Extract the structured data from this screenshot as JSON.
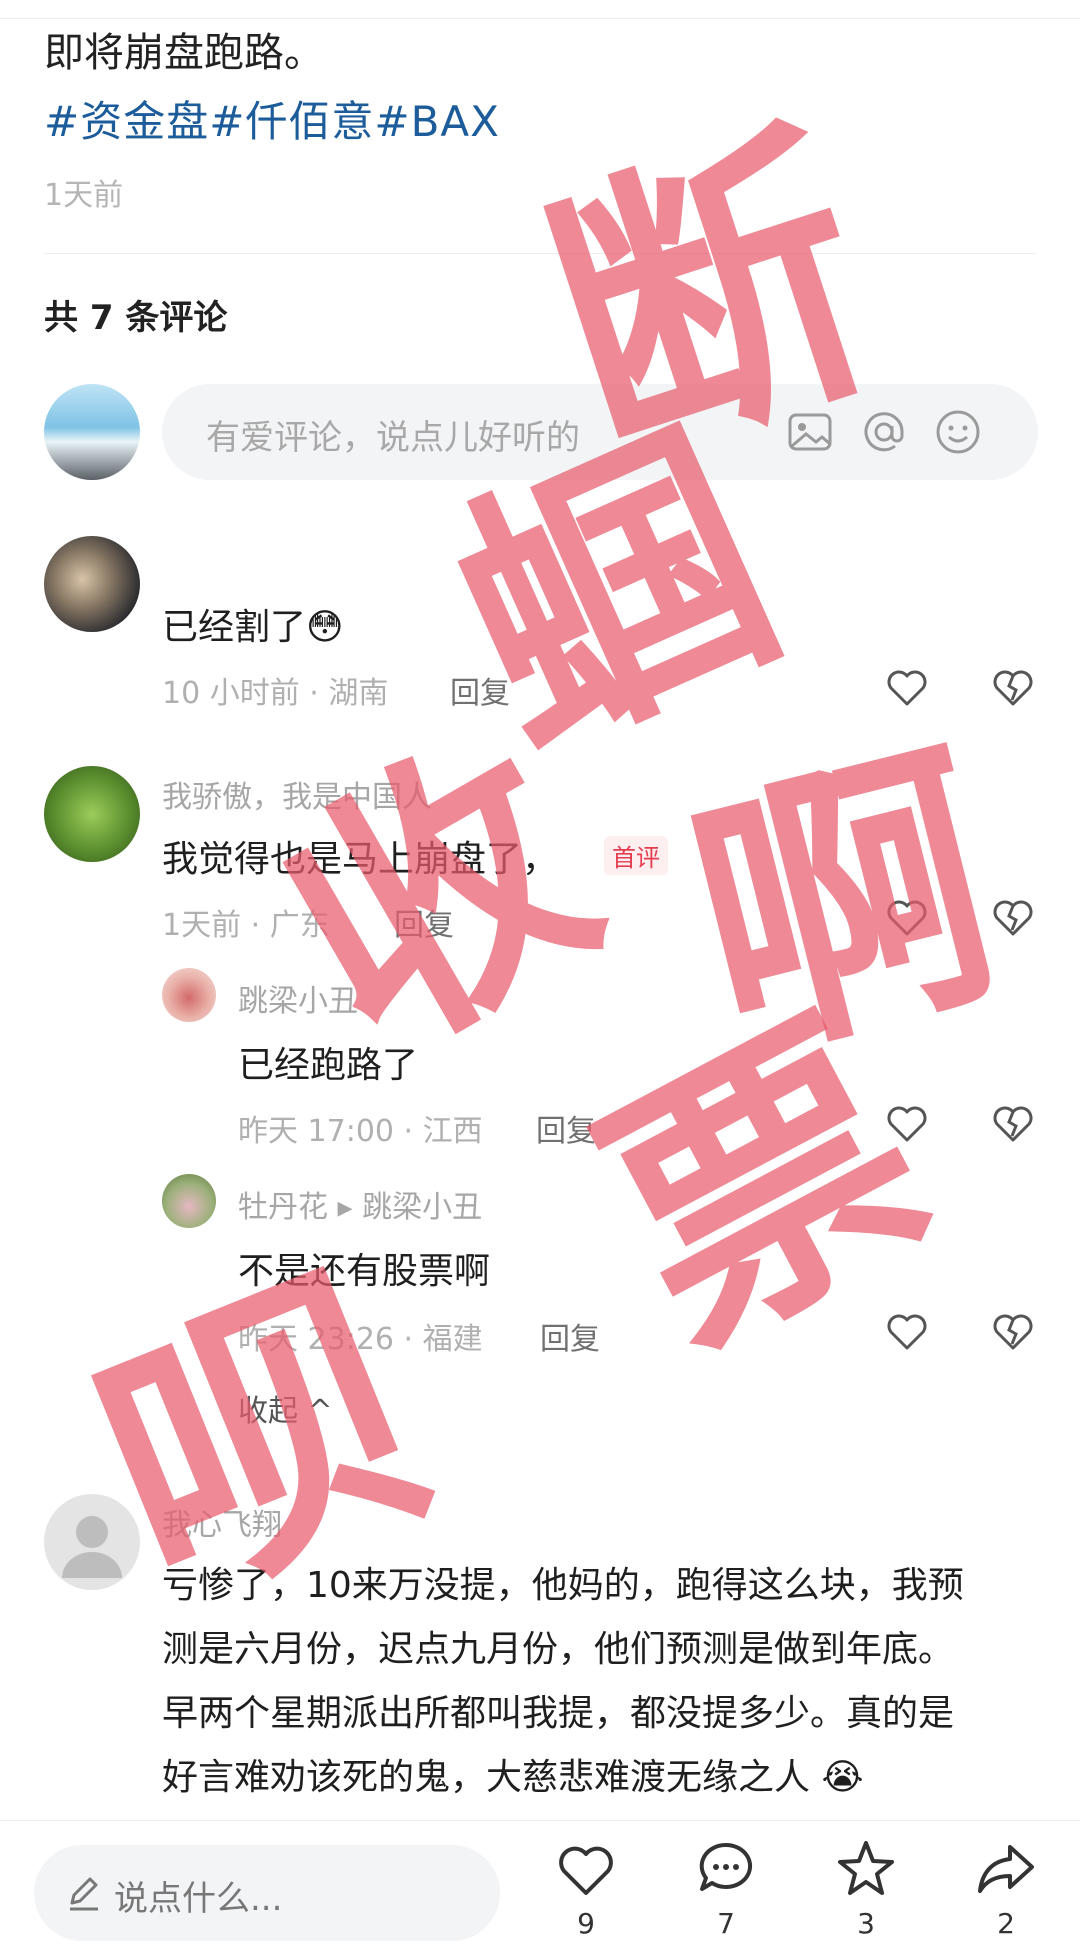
{
  "post": {
    "line": "即将崩盘跑路。",
    "hashtags": "#资金盘#仟佰意#BAX",
    "time": "1天前"
  },
  "comments_header": "共 7 条评论",
  "input": {
    "placeholder": "有爱评论，说点儿好听的"
  },
  "comments": [
    {
      "name": "",
      "text": "已经割了😳",
      "meta": "10 小时前 · 湖南",
      "reply": "回复"
    },
    {
      "name": "我骄傲，我是中国人",
      "text": "我觉得也是马上崩盘了，",
      "badge": "首评",
      "meta": "1天前 · 广东",
      "reply": "回复"
    },
    {
      "name": "跳梁小丑",
      "text": "已经跑路了",
      "meta": "昨天 17:00 · 江西",
      "reply": "回复"
    },
    {
      "name": "牡丹花 ▸ 跳梁小丑",
      "text": "不是还有股票啊",
      "meta": "昨天 23:26 · 福建",
      "reply": "回复"
    },
    {
      "name": "我心飞翔",
      "text_lines": [
        "亏惨了，10来万没提，他妈的，跑得这么块，我预",
        "测是六月份，迟点九月份，他们预测是做到年底。",
        "早两个星期派出所都叫我提，都没提多少。真的是",
        "好言难劝该死的鬼，大慈悲难渡无缘之人 😭"
      ]
    }
  ],
  "collapse_label": "收起 ^",
  "bottom_bar": {
    "placeholder": "说点什么...",
    "likes": "9",
    "comments": "7",
    "stars": "3",
    "shares": "2"
  },
  "watermark": {
    "chars": [
      "断",
      "蝈",
      "收",
      "呗",
      "啊",
      "票"
    ],
    "color": "#e85c6c"
  }
}
